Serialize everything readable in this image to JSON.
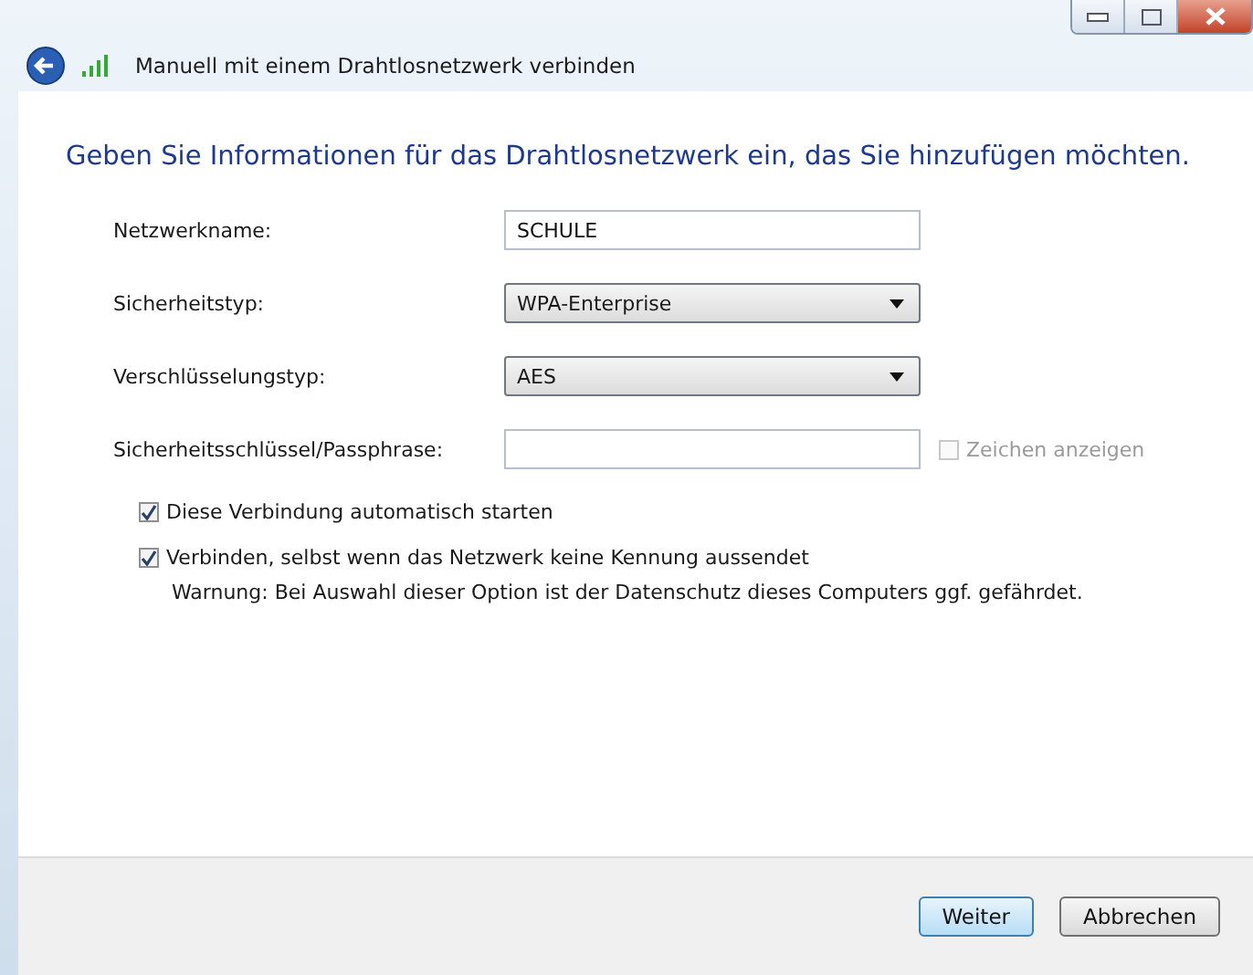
{
  "header": {
    "title": "Manuell mit einem Drahtlosnetzwerk verbinden"
  },
  "heading": "Geben Sie Informationen für das Drahtlosnetzwerk ein, das Sie hinzufügen möchten.",
  "fields": [
    {
      "kind": "text",
      "label": "Netzwerkname:",
      "value": "SCHULE"
    },
    {
      "kind": "dropdown",
      "label": "Sicherheitstyp:",
      "value": "WPA-Enterprise"
    },
    {
      "kind": "dropdown",
      "label": "Verschlüsselungstyp:",
      "value": "AES"
    },
    {
      "kind": "text",
      "label": "Sicherheitsschlüssel/Passphrase:",
      "extra": {
        "label": "Zeichen anzeigen",
        "checked": false,
        "disabled": true
      }
    }
  ],
  "options": [
    {
      "label": "Diese Verbindung automatisch starten",
      "checked": true
    },
    {
      "label": "Verbinden, selbst wenn das Netzwerk keine Kennung aussendet",
      "checked": true,
      "note": "Warnung: Bei Auswahl dieser Option ist der Datenschutz dieses Computers ggf. gefährdet."
    }
  ],
  "buttons": [
    {
      "label": "Weiter",
      "selected": true
    },
    {
      "label": "Abbrechen",
      "selected": false
    }
  ]
}
